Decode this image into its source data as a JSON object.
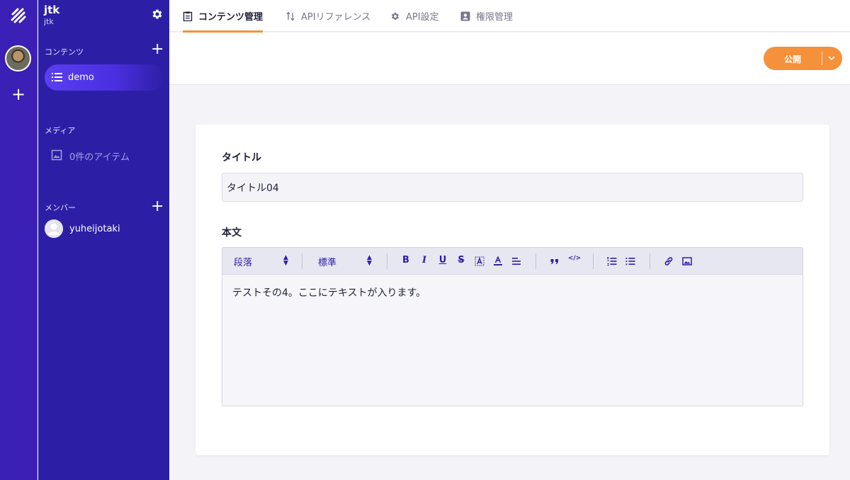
{
  "sidebar": {
    "service_name": "jtk",
    "service_id": "jtk",
    "contents_title": "コンテンツ",
    "contents_item": "demo",
    "media_title": "メディア",
    "media_item": "0件のアイテム",
    "members_title": "メンバー",
    "member_name": "yuheijotaki"
  },
  "tabs": [
    {
      "label": "コンテンツ管理",
      "icon": "clipboard-icon",
      "active": true
    },
    {
      "label": "APIリファレンス",
      "icon": "swap-vert-icon",
      "active": false
    },
    {
      "label": "API設定",
      "icon": "gear-icon",
      "active": false
    },
    {
      "label": "権限管理",
      "icon": "account-box-icon",
      "active": false
    }
  ],
  "actions": {
    "publish_label": "公開"
  },
  "form": {
    "title_label": "タイトル",
    "title_value": "タイトル04",
    "body_label": "本文",
    "toolbar": {
      "block_format": "段落",
      "font_size": "標準",
      "bold": "B",
      "italic": "I",
      "underline": "U",
      "strike": "S",
      "code": "</>"
    },
    "body_text": "テストその4。ここにテキストが入ります。"
  },
  "colors": {
    "rail": "#3a20b4",
    "sidebar": "#2d1fa5",
    "accent": "#f4913a",
    "toolbar_icon": "#2d1fa5"
  }
}
